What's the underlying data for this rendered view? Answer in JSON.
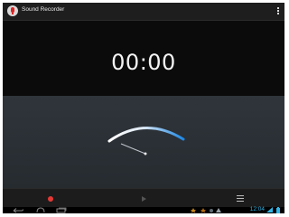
{
  "app": {
    "title": "Sound Recorder"
  },
  "timer": {
    "value": "00:00"
  },
  "controls": {
    "record_icon": "record-icon",
    "play_icon": "play-icon",
    "list_icon": "list-icon"
  },
  "system_bar": {
    "time": "12:04",
    "icons": [
      "back-icon",
      "home-icon",
      "recent-apps-icon",
      "notification-icon",
      "wifi-icon",
      "battery-icon"
    ]
  },
  "colors": {
    "accent": "#33b5e5",
    "record": "#e53935",
    "meter_arc_start": "#ffffff",
    "meter_arc_end": "#1e88e5"
  },
  "meter": {
    "level": 0
  }
}
